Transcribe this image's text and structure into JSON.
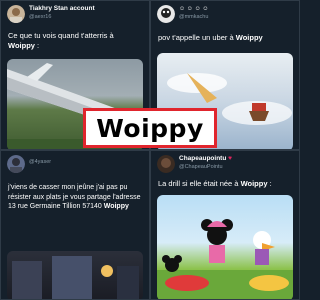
{
  "tweets": [
    {
      "name": "Tiakhry Stan account",
      "handle": "@aexr16",
      "text_prefix": "Ce que tu vois quand t'atterris à",
      "text_bold": "Woippy",
      "text_suffix": " :"
    },
    {
      "name": "",
      "handle": "@mmkachu",
      "text_prefix": "pov t'appelle un uber à ",
      "text_bold": "Woippy",
      "text_suffix": ""
    },
    {
      "name": "",
      "handle": "@4yaser",
      "text_prefix": "j'viens de casser mon jeûne j'ai pas pu résister aux plats je vous partage l'adresse 13 rue Germaine Tillion 57140 ",
      "text_bold": "Woippy",
      "text_suffix": ""
    },
    {
      "name": "Chapeaupointu",
      "handle": "@ChapeauPointu",
      "text_prefix": "La drill si elle était née à ",
      "text_bold": "Woippy",
      "text_suffix": " :"
    }
  ],
  "overlay": {
    "label": "Woippy"
  },
  "colors": {
    "background": "#15202b",
    "overlay_border": "#e0252d",
    "handle": "#8899a6"
  }
}
